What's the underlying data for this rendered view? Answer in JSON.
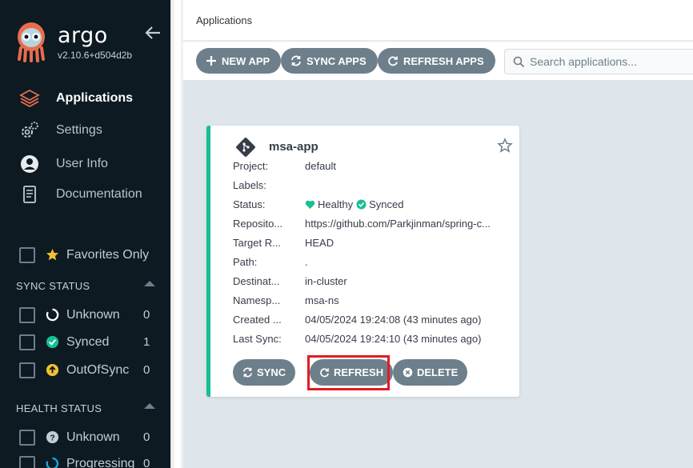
{
  "sidebar": {
    "brand": "argo",
    "version": "v2.10.6+d504d2b",
    "nav": [
      {
        "label": "Applications",
        "icon": "layers-icon",
        "active": true
      },
      {
        "label": "Settings",
        "icon": "gears-icon"
      },
      {
        "label": "User Info",
        "icon": "user-circle-icon"
      },
      {
        "label": "Documentation",
        "icon": "book-icon"
      }
    ],
    "favorites_label": "Favorites Only",
    "sync_status": {
      "title": "SYNC STATUS",
      "items": [
        {
          "label": "Unknown",
          "count": "0",
          "icon": "circle-notch-icon"
        },
        {
          "label": "Synced",
          "count": "1",
          "icon": "check-circle-icon"
        },
        {
          "label": "OutOfSync",
          "count": "0",
          "icon": "arrow-up-circle-icon"
        }
      ]
    },
    "health_status": {
      "title": "HEALTH STATUS",
      "items": [
        {
          "label": "Unknown",
          "count": "0",
          "icon": "question-circle-icon"
        },
        {
          "label": "Progressing",
          "count": "0",
          "icon": "spinner-icon"
        }
      ]
    }
  },
  "header": {
    "title": "Applications"
  },
  "toolbar": {
    "new_app": "NEW APP",
    "sync_apps": "SYNC APPS",
    "refresh_apps": "REFRESH APPS",
    "search_placeholder": "Search applications..."
  },
  "app_card": {
    "name": "msa-app",
    "fields": [
      {
        "key": "Project:",
        "value": "default"
      },
      {
        "key": "Labels:",
        "value": ""
      },
      {
        "key": "Status:",
        "health": "Healthy",
        "sync": "Synced"
      },
      {
        "key": "Reposito...",
        "value": "https://github.com/Parkjinman/spring-c..."
      },
      {
        "key": "Target R...",
        "value": "HEAD"
      },
      {
        "key": "Path:",
        "value": "."
      },
      {
        "key": "Destinat...",
        "value": "in-cluster"
      },
      {
        "key": "Namesp...",
        "value": "msa-ns"
      },
      {
        "key": "Created ...",
        "value": "04/05/2024 19:24:08  (43 minutes ago)"
      },
      {
        "key": "Last Sync:",
        "value": "04/05/2024 19:24:10  (43 minutes ago)"
      }
    ],
    "buttons": {
      "sync": "SYNC",
      "refresh": "REFRESH",
      "delete": "DELETE"
    }
  },
  "colors": {
    "sidebar_bg": "#0d1a22",
    "button_gray": "#6d7f8b",
    "healthy_green": "#18be94",
    "accent_orange": "#e96d4c",
    "outofsync_yellow": "#f4c030",
    "highlight_red": "#e31b23"
  }
}
